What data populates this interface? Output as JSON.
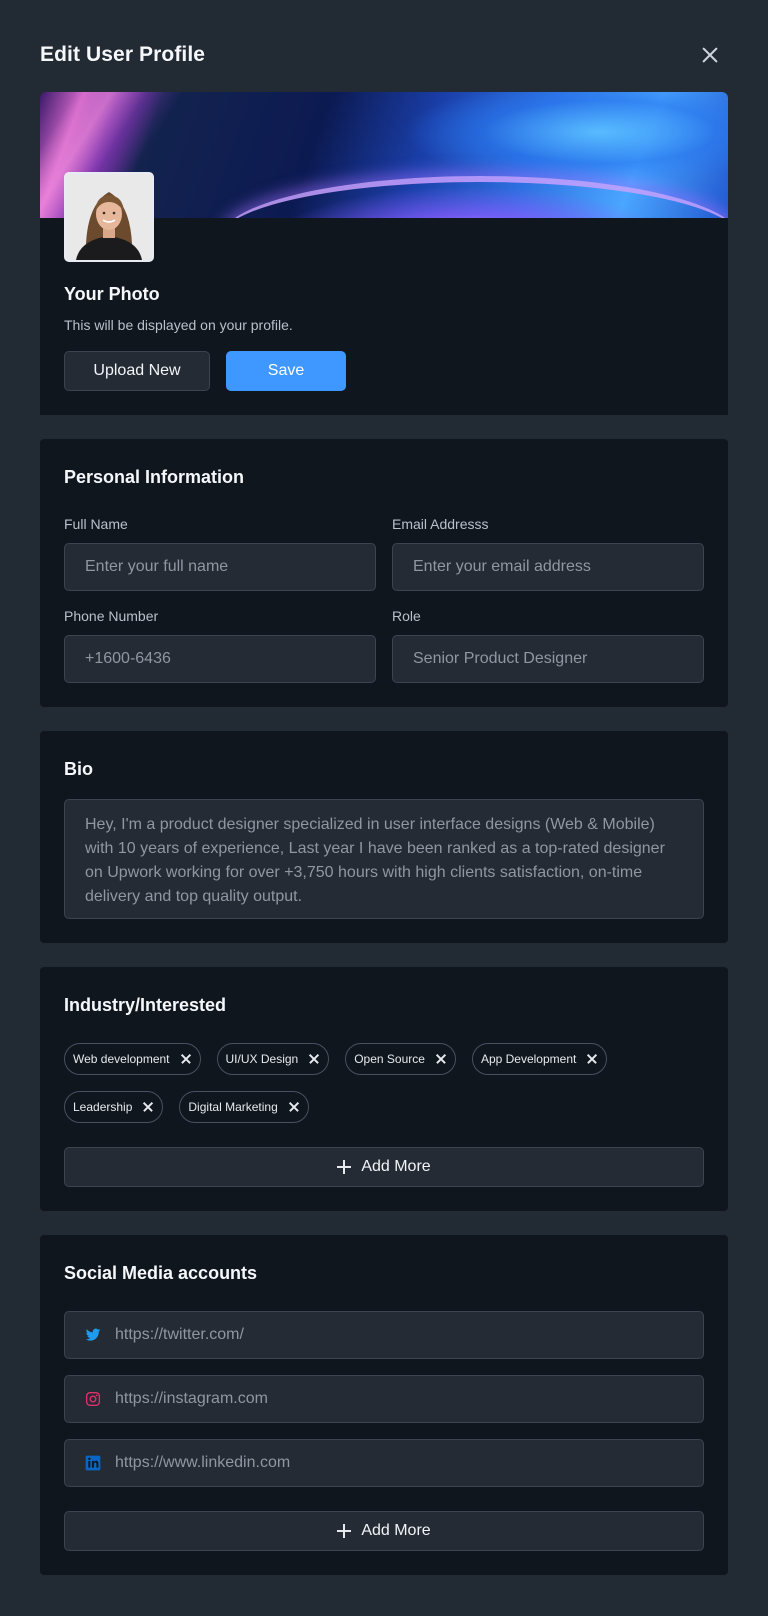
{
  "dialog": {
    "title": "Edit User Profile"
  },
  "photo": {
    "title": "Your Photo",
    "subtitle": "This will be displayed on your profile.",
    "upload_label": "Upload New",
    "save_label": "Save"
  },
  "personal": {
    "title": "Personal Information",
    "full_name": {
      "label": "Full Name",
      "placeholder": "Enter your full name"
    },
    "email": {
      "label": "Email Addresss",
      "placeholder": "Enter your email address"
    },
    "phone": {
      "label": "Phone Number",
      "value": "+1600-6436"
    },
    "role": {
      "label": "Role",
      "value": "Senior Product Designer"
    }
  },
  "bio": {
    "title": "Bio",
    "text": "Hey, I'm a product designer specialized in user interface designs (Web & Mobile) with 10 years of experience, Last year I have been ranked as a top-rated designer on Upwork working for over +3,750 hours with high clients satisfaction, on-time delivery and top quality output."
  },
  "industry": {
    "title": "Industry/Interested",
    "tags": [
      "Web development",
      "UI/UX Design",
      "Open Source",
      "App Development",
      "Leadership",
      "Digital Marketing"
    ],
    "add_more_label": "Add More"
  },
  "social": {
    "title": "Social Media accounts",
    "accounts": [
      {
        "icon": "twitter-icon",
        "value": "https://twitter.com/"
      },
      {
        "icon": "instagram-icon",
        "value": "https://instagram.com"
      },
      {
        "icon": "linkedin-icon",
        "value": "https://www.linkedin.com"
      }
    ],
    "add_more_label": "Add More"
  },
  "colors": {
    "background": "#222a33",
    "card": "#10161e",
    "input": "#242b34",
    "primary": "#3f98ff",
    "twitter": "#1d9bf0",
    "instagram": "#e1306c",
    "linkedin": "#0a66c2"
  }
}
